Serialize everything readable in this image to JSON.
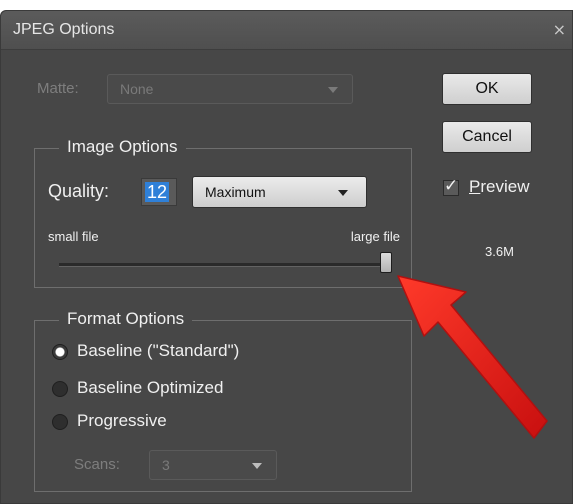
{
  "dialog": {
    "title": "JPEG Options",
    "close_glyph": "×"
  },
  "matte": {
    "label": "Matte:",
    "value": "None",
    "enabled": false
  },
  "buttons": {
    "ok": "OK",
    "cancel": "Cancel"
  },
  "preview": {
    "label_first": "P",
    "label_rest": "review",
    "checked": true,
    "check_glyph": "✓",
    "file_size": "3.6M"
  },
  "image_options": {
    "legend": "Image Options",
    "quality_label": "Quality:",
    "quality_value": "12",
    "quality_preset": "Maximum",
    "slider": {
      "min_label": "small file",
      "max_label": "large file",
      "position_fraction": 1.0
    }
  },
  "format_options": {
    "legend": "Format Options",
    "options": [
      {
        "label": "Baseline (\"Standard\")",
        "selected": true
      },
      {
        "label": "Baseline Optimized",
        "selected": false
      },
      {
        "label": "Progressive",
        "selected": false
      }
    ],
    "scans_label": "Scans:",
    "scans_value": "3",
    "scans_enabled": false
  },
  "colors": {
    "dialog_bg": "#474747",
    "highlight": "#2f80d8",
    "annotation_arrow": "#e01818"
  },
  "icons": [
    "close-icon",
    "chevron-down-icon",
    "checkmark-icon",
    "radio-icon",
    "annotation-arrow"
  ]
}
